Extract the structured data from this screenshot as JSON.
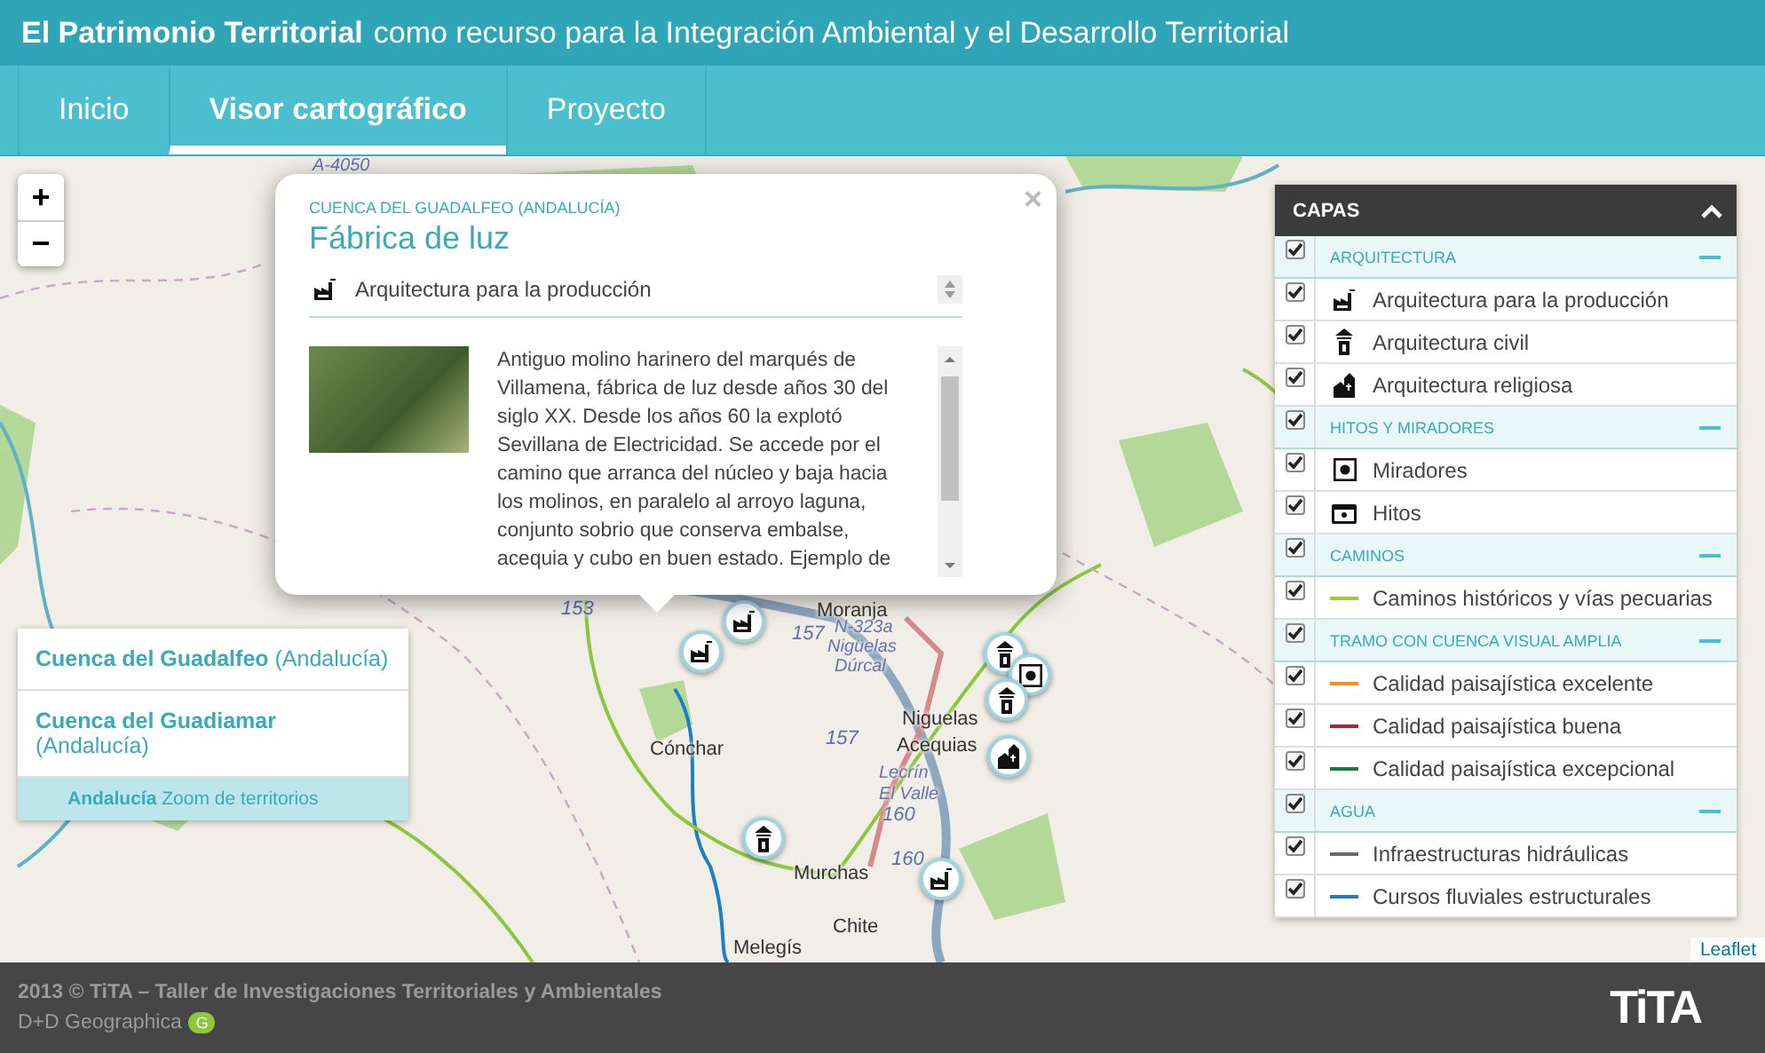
{
  "header": {
    "title": "El Patrimonio Territorial",
    "subtitle": "como recurso para la Integración Ambiental y el Desarrollo Territorial"
  },
  "tabs": [
    {
      "label": "Inicio",
      "selected": false
    },
    {
      "label": "Visor cartográfico",
      "selected": true
    },
    {
      "label": "Proyecto",
      "selected": false
    }
  ],
  "map": {
    "zoom_in": "+",
    "zoom_out": "−",
    "labels": [
      "A-4050",
      "Moranja",
      "N-323a",
      "Nigüelas",
      "Dúrcal",
      "Niguelas",
      "Cónchar",
      "Acequias",
      "Lecrín",
      "El Valle",
      "Murchas",
      "Chite",
      "Melegís",
      "153",
      "157",
      "157",
      "160",
      "160"
    ],
    "attribution": "Leaflet"
  },
  "popup": {
    "region": "CUENCA DEL GUADALFEO (ANDALUCÍA)",
    "title": "Fábrica de luz",
    "close": "×",
    "category": {
      "label": "Arquitectura para la producción"
    },
    "description": "Antiguo molino harinero del marqués de Villamena, fábrica de luz desde años 30 del siglo XX. Desde los años 60 la explotó Sevillana de Electricidad. Se accede por el camino que arranca del núcleo y baja hacia los molinos, en paralelo al arroyo laguna, conjunto sobrio que conserva embalse, acequia y cubo en buen estado. Ejemplo de"
  },
  "territories": {
    "items": [
      "**Cuenca del Guadalfeo** (Andalucía)",
      "**Cuenca del Guadiamar** (Andalucía)"
    ],
    "footer": "**Andalucía** Zoom de territorios"
  },
  "layers": {
    "title": "CAPAS",
    "groups": [
      {
        "label": "ARQUITECTURA",
        "checked": true,
        "expanded": true,
        "items": [
          {
            "label": "Arquitectura para la producción",
            "checked": true,
            "kind": "icon"
          },
          {
            "label": "Arquitectura civil",
            "checked": true,
            "kind": "icon"
          },
          {
            "label": "Arquitectura religiosa",
            "checked": true,
            "kind": "icon"
          }
        ]
      },
      {
        "label": "HITOS Y MIRADORES",
        "checked": true,
        "expanded": true,
        "items": [
          {
            "label": "Miradores",
            "checked": true,
            "kind": "icon"
          },
          {
            "label": "Hitos",
            "checked": true,
            "kind": "icon"
          }
        ]
      },
      {
        "label": "CAMINOS",
        "checked": true,
        "expanded": true,
        "items": [
          {
            "label": "Caminos históricos y vías pecuarias",
            "checked": true,
            "kind": "line",
            "color": "#9acd32"
          }
        ]
      },
      {
        "label": "TRAMO CON CUENCA VISUAL AMPLIA",
        "checked": true,
        "expanded": true,
        "items": [
          {
            "label": "Calidad paisajística excelente",
            "checked": true,
            "kind": "line",
            "color": "#f0901e"
          },
          {
            "label": "Calidad paisajística buena",
            "checked": true,
            "kind": "line",
            "color": "#b22234"
          },
          {
            "label": "Calidad paisajística excepcional",
            "checked": true,
            "kind": "line",
            "color": "#1e7a3a"
          }
        ]
      },
      {
        "label": "AGUA",
        "checked": true,
        "expanded": true,
        "items": [
          {
            "label": "Infraestructuras hidráulicas",
            "checked": true,
            "kind": "line",
            "color": "#6b6b6b"
          },
          {
            "label": "Cursos fluviales estructurales",
            "checked": true,
            "kind": "line",
            "color": "#2a7ab0"
          }
        ]
      }
    ]
  },
  "footer": {
    "credit": "2013 © TiTA – Taller de Investigaciones Territoriales y Ambientales",
    "partner": "D+D Geographica",
    "partner_badge": "G",
    "logo": "TiTA"
  }
}
